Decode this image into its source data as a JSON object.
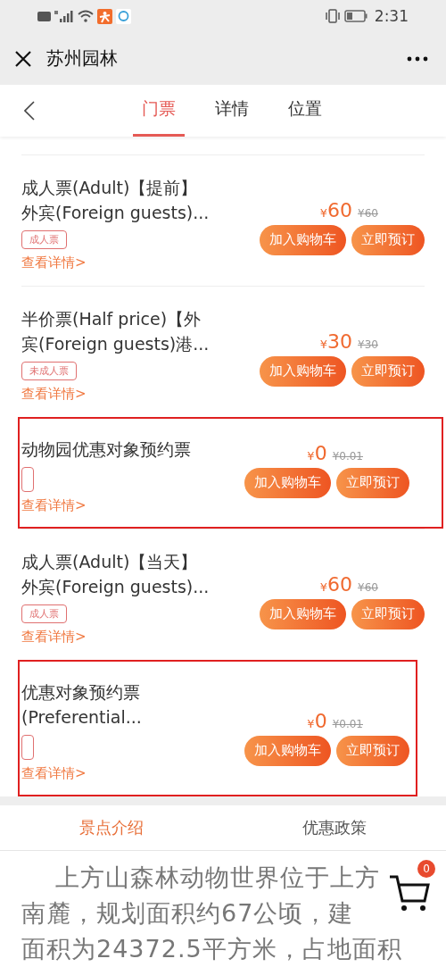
{
  "status_bar": {
    "time": "2:31"
  },
  "nav_bar": {
    "title": "苏州园林"
  },
  "tabs": [
    {
      "label": "门票",
      "selected": true
    },
    {
      "label": "详情",
      "selected": false
    },
    {
      "label": "位置",
      "selected": false
    }
  ],
  "tickets": [
    {
      "name_lines": [
        "成人票(Adult)【提前】",
        "外宾(Foreign guests)..."
      ],
      "has_tag": true,
      "tag_label": "成人票",
      "link": "查看详情>",
      "currency": "¥",
      "price": "60",
      "original_price": "¥60",
      "cart_button": "加入购物车",
      "book_button": "立即预订",
      "highlighted": false
    },
    {
      "name_lines": [
        "半价票(Half price)【外",
        "宾(Foreign guests)港..."
      ],
      "has_tag": true,
      "tag_label": "未成人票",
      "link": "查看详情>",
      "currency": "¥",
      "price": "30",
      "original_price": "¥30",
      "cart_button": "加入购物车",
      "book_button": "立即预订",
      "highlighted": false
    },
    {
      "name_lines": [
        "动物园优惠对象预约票"
      ],
      "has_tag": true,
      "link": "查看详情>",
      "currency": "¥",
      "price": "0",
      "original_price": "¥0.01",
      "cart_button": "加入购物车",
      "book_button": "立即预订",
      "highlighted": true
    },
    {
      "name_lines": [
        "成人票(Adult)【当天】",
        "外宾(Foreign guests)..."
      ],
      "has_tag": true,
      "tag_label": "成人票",
      "link": "查看详情>",
      "currency": "¥",
      "price": "60",
      "original_price": "¥60",
      "cart_button": "加入购物车",
      "book_button": "立即预订",
      "highlighted": false
    },
    {
      "name_lines": [
        "优惠对象预约票",
        "(Preferential..."
      ],
      "has_tag": true,
      "link": "查看详情>",
      "currency": "¥",
      "price": "0",
      "original_price": "¥0.01",
      "cart_button": "加入购物车",
      "book_button": "立即预订",
      "highlighted": true
    }
  ],
  "info_tabs": [
    {
      "label": "景点介绍",
      "selected": true
    },
    {
      "label": "优惠政策",
      "selected": false
    }
  ],
  "intro_lines": [
    "上方山森林动物世界位于上方",
    "南麓，规划面积约67公顷，建",
    "面积为24372.5平方米，占地面积"
  ],
  "cart": {
    "count": "0"
  }
}
